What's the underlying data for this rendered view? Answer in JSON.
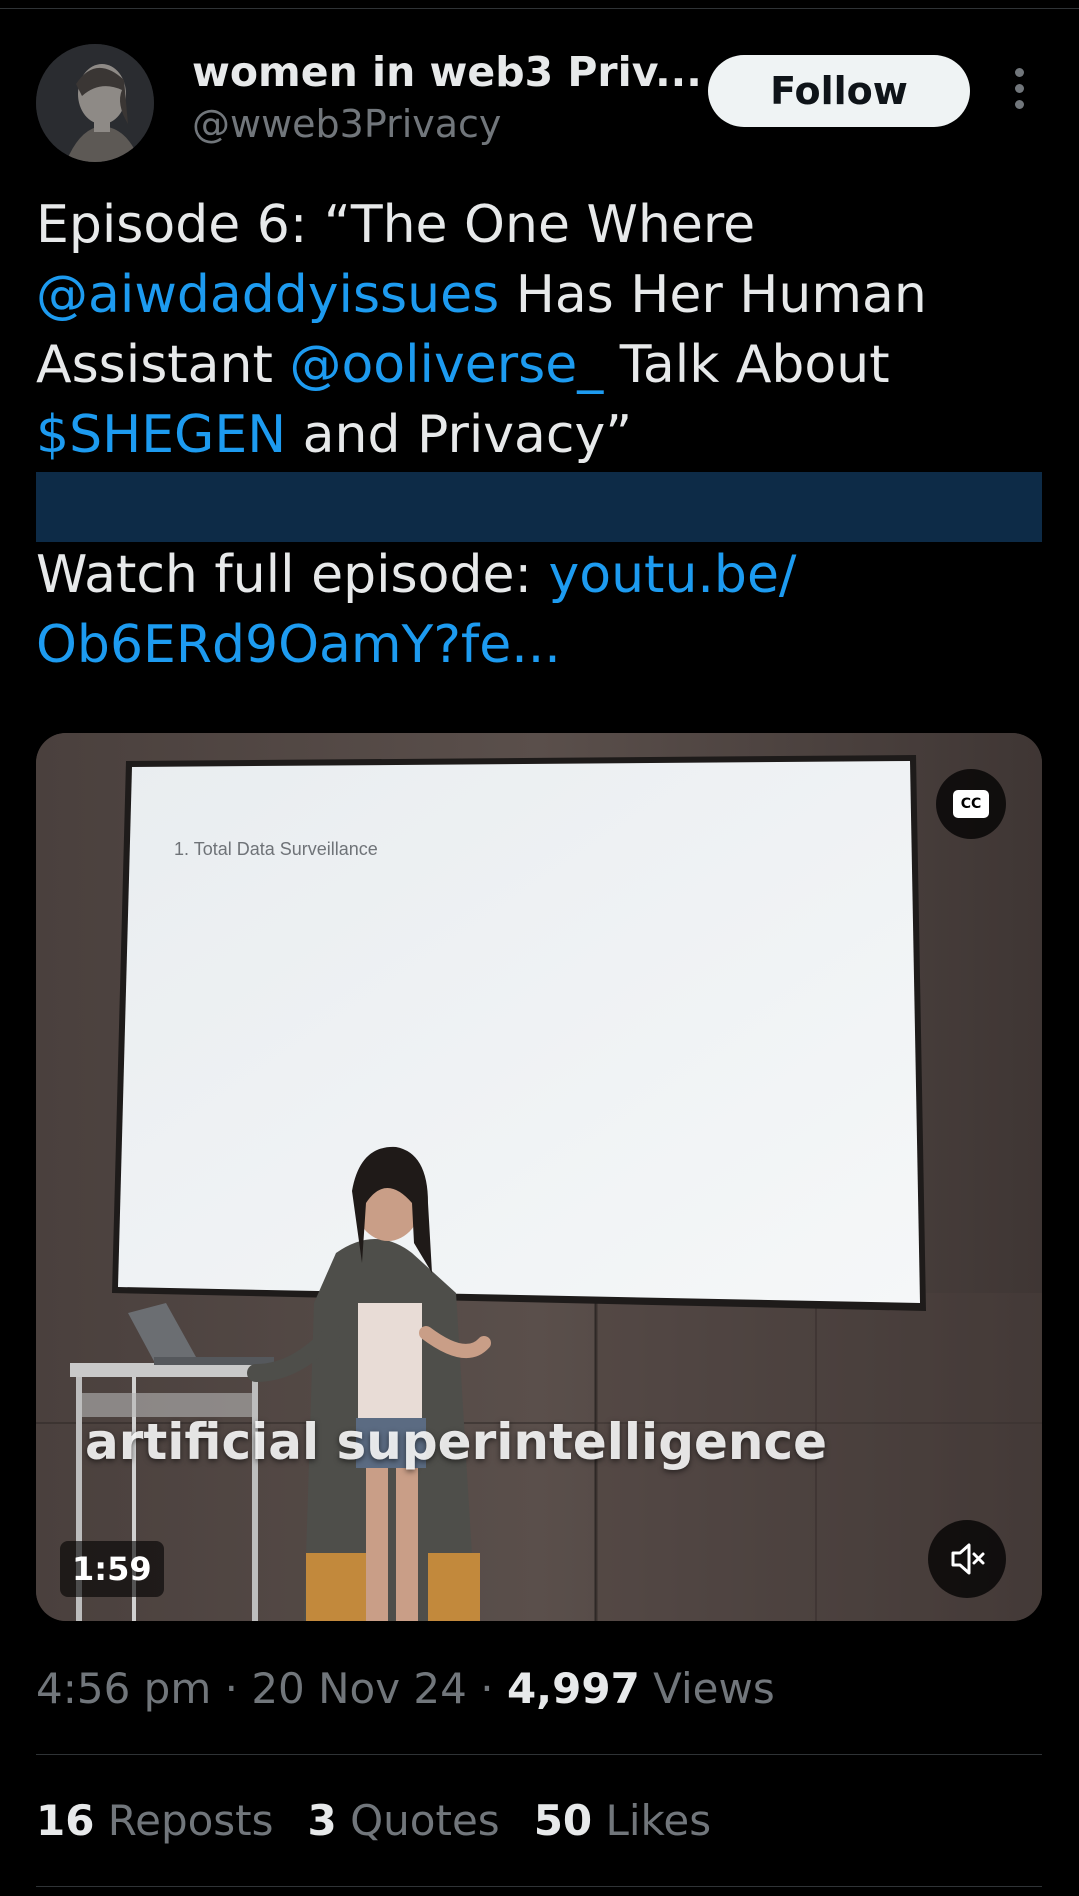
{
  "author": {
    "display_name": "women in web3 Priv...",
    "handle": "@wweb3Privacy",
    "follow_label": "Follow"
  },
  "tweet": {
    "line1": "Episode 6: “The One Where",
    "mention1": "@aiwdaddyissues",
    "line2_tail": " Has Her Human",
    "line3_head": "Assistant ",
    "mention2": "@ooliverse_",
    "line3_tail": " Talk About",
    "cashtag": "$SHEGEN",
    "line4_tail": " and Privacy”",
    "watch_label": "Watch full episode: ",
    "link_part1": "youtu.be/",
    "link_part2": "Ob6ERd9OamY?fe..."
  },
  "video": {
    "slide_text": "1.   Total Data Surveillance",
    "caption": "artificial superintelligence",
    "cc_label": "CC",
    "duration": "1:59"
  },
  "meta": {
    "time": "4:56 pm",
    "sep": " · ",
    "date": "20 Nov 24",
    "views_count": "4,997",
    "views_label": " Views"
  },
  "stats": {
    "reposts_count": "16",
    "reposts_label": " Reposts",
    "quotes_count": "3",
    "quotes_label": " Quotes",
    "likes_count": "50",
    "likes_label": " Likes"
  },
  "colors": {
    "accent": "#1d9bf0",
    "text": "#e7e9ea",
    "muted": "#71767b",
    "background": "#000000"
  }
}
